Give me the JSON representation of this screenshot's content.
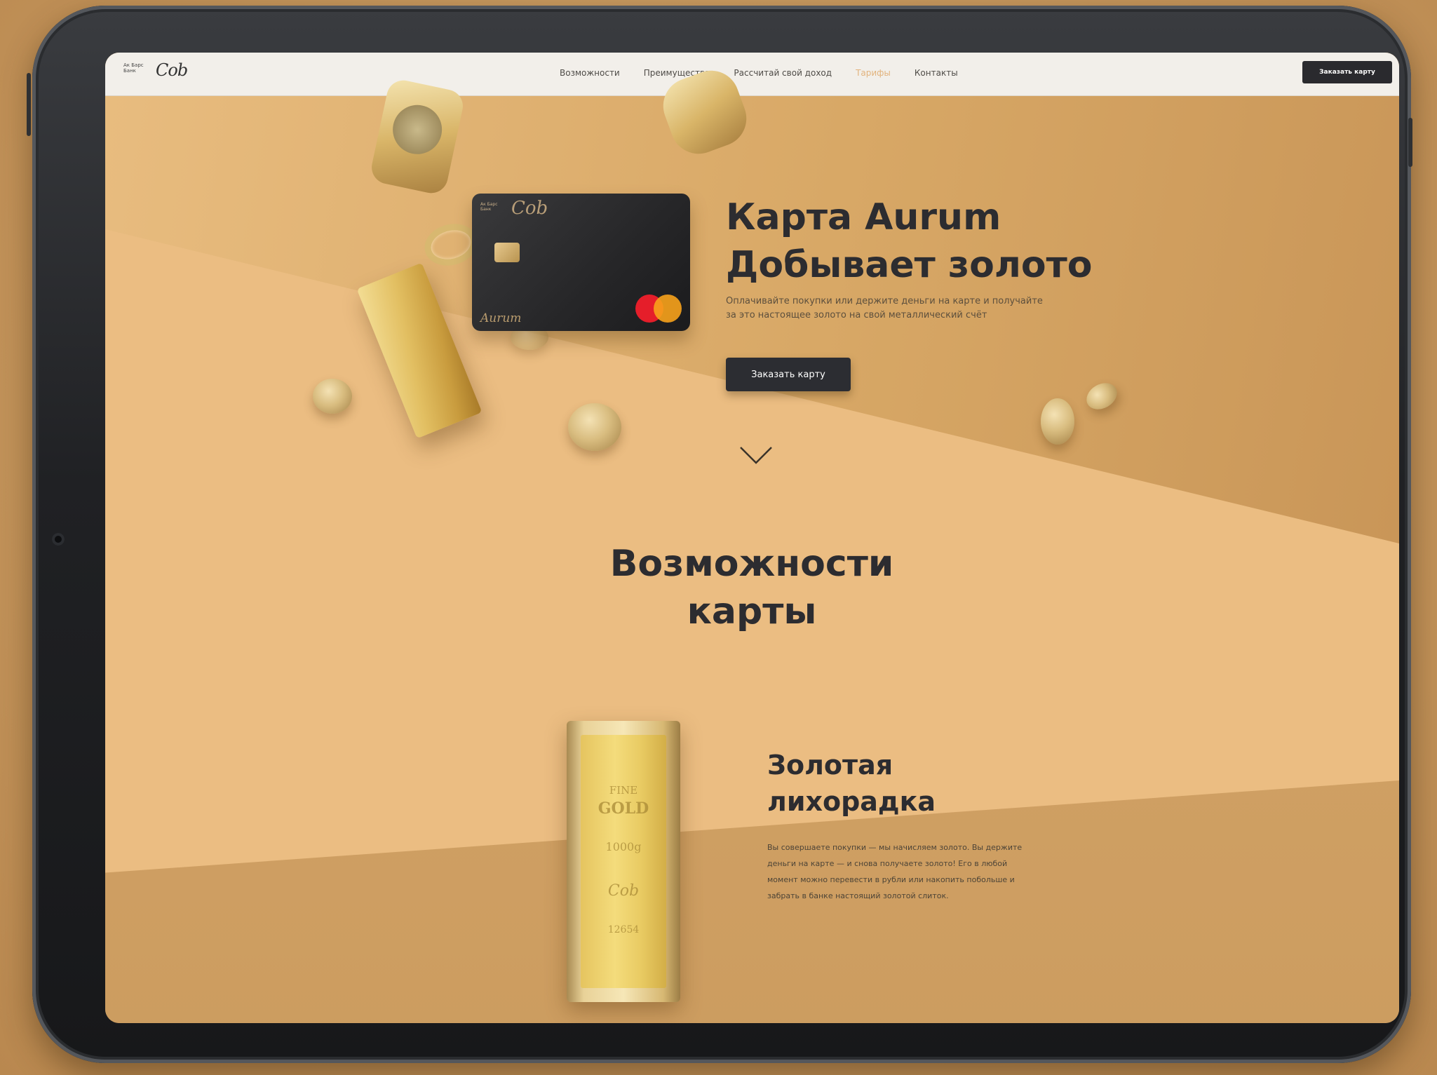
{
  "nav": {
    "logo_small": "Ак Барс\nБанк",
    "logo_script": "Cob",
    "links": [
      "Возможности",
      "Преимущества",
      "Рассчитай свой доход",
      "Тарифы",
      "Контакты"
    ],
    "order_label": "Заказать карту"
  },
  "card": {
    "bank": "Ак Барс\nБанк",
    "logo": "Cob",
    "name": "Aurum"
  },
  "hero": {
    "title_line1": "Карта Aurum",
    "title_line2": "Добывает золото",
    "description": "Оплачивайте покупки или держите деньги на карте и получайте за это настоящее золото на свой металлический счёт",
    "button_label": "Заказать карту"
  },
  "features": {
    "title_line1": "Возможности",
    "title_line2": "карты",
    "item": {
      "title_line1": "Золотая",
      "title_line2": "лихорадка",
      "description": "Вы совершаете покупки — мы начисляем золото. Вы держите деньги на карте — и снова получаете золото! Его в любой момент можно перевести в рубли или накопить побольше и забрать в банке настоящий золотой слиток."
    }
  },
  "gold_bar_stamp": {
    "line1": "FINE",
    "line2": "GOLD",
    "line3": "1000g",
    "line4": "Cob",
    "line5": "12654"
  },
  "colors": {
    "accent_dark": "#2c2d32",
    "gold": "#e2b37d",
    "background": "#ebbd82"
  }
}
